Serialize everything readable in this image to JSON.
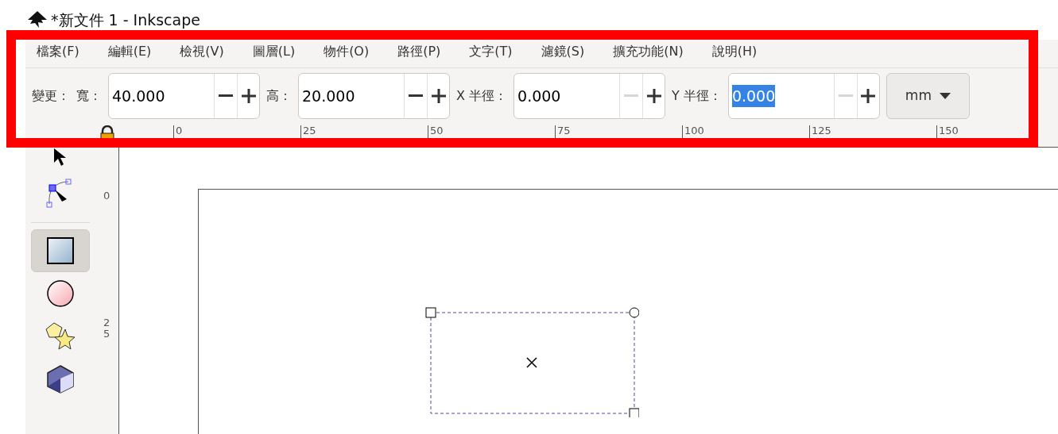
{
  "window": {
    "title": "*新文件 1 - Inkscape"
  },
  "menu": [
    "檔案(F)",
    "編輯(E)",
    "檢視(V)",
    "圖層(L)",
    "物件(O)",
    "路徑(P)",
    "文字(T)",
    "濾鏡(S)",
    "擴充功能(N)",
    "說明(H)"
  ],
  "toolbar": {
    "label": "變更：",
    "fields": [
      {
        "label": "寬：",
        "value": "40.000",
        "text_selected": false,
        "minus_disabled": false
      },
      {
        "label": "高：",
        "value": "20.000",
        "text_selected": false,
        "minus_disabled": false
      },
      {
        "label": "X 半徑：",
        "value": "0.000",
        "text_selected": false,
        "minus_disabled": true
      },
      {
        "label": "Y 半徑：",
        "value": "0.000",
        "text_selected": true,
        "minus_disabled": true
      }
    ],
    "unit": "mm"
  },
  "ruler": {
    "horizontal": [
      "0",
      "25",
      "50",
      "75",
      "100",
      "125",
      "150"
    ],
    "vertical": [
      "0",
      "25"
    ]
  },
  "tools": [
    {
      "kind": "selector",
      "selected": false
    },
    {
      "kind": "node",
      "selected": false
    },
    {
      "kind": "separator"
    },
    {
      "kind": "rect",
      "selected": true
    },
    {
      "kind": "ellipse",
      "selected": false
    },
    {
      "kind": "star",
      "selected": false
    },
    {
      "kind": "box3d",
      "selected": false
    }
  ]
}
